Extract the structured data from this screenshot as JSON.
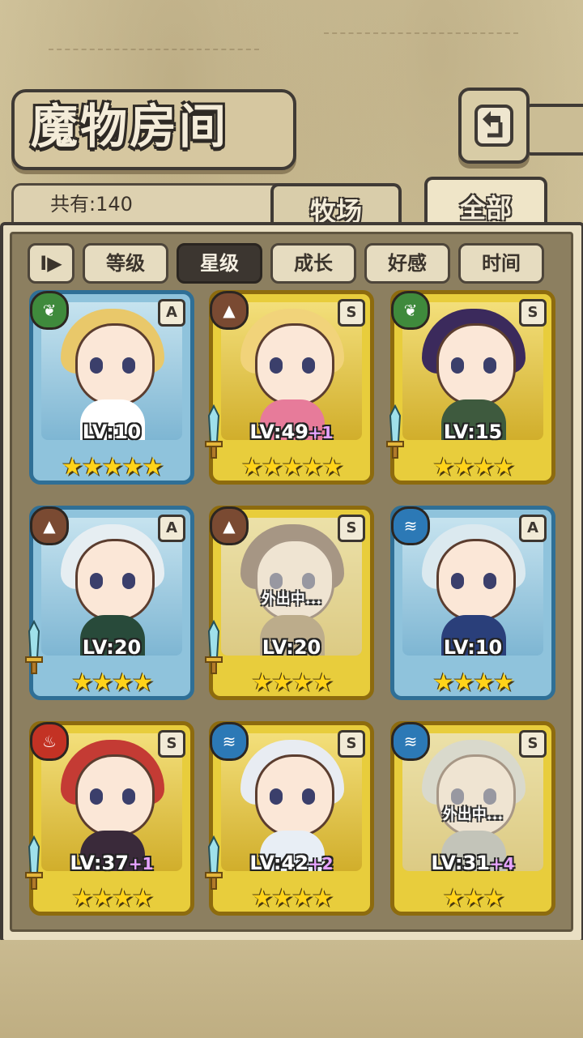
{
  "header": {
    "title": "魔物房间",
    "back_icon": "back-arrow-icon"
  },
  "count": {
    "text": "共有:140"
  },
  "tabs": [
    {
      "label": "牧场",
      "active": false
    },
    {
      "label": "全部",
      "active": true
    }
  ],
  "sort": {
    "toggle_label": "I▶",
    "buttons": [
      {
        "label": "等级",
        "active": false
      },
      {
        "label": "星级",
        "active": true
      },
      {
        "label": "成长",
        "active": false
      },
      {
        "label": "好感",
        "active": false
      },
      {
        "label": "时间",
        "active": false
      }
    ]
  },
  "away_label": "外出中...",
  "cards": [
    {
      "rarity": "A",
      "element": "wood",
      "level": "LV:10",
      "plus": "",
      "stars": "★★★★★",
      "away": false,
      "weapon": false
    },
    {
      "rarity": "S",
      "element": "earth",
      "level": "LV:49",
      "plus": "+1",
      "stars": "★★★★★",
      "away": false,
      "weapon": true
    },
    {
      "rarity": "S",
      "element": "wood",
      "level": "LV:15",
      "plus": "",
      "stars": "★★★★",
      "away": false,
      "weapon": true
    },
    {
      "rarity": "A",
      "element": "earth",
      "level": "LV:20",
      "plus": "",
      "stars": "★★★★",
      "away": false,
      "weapon": true
    },
    {
      "rarity": "S",
      "element": "earth",
      "level": "LV:20",
      "plus": "",
      "stars": "★★★★",
      "away": true,
      "weapon": true
    },
    {
      "rarity": "A",
      "element": "water",
      "level": "LV:10",
      "plus": "",
      "stars": "★★★★",
      "away": false,
      "weapon": false
    },
    {
      "rarity": "S",
      "element": "fire",
      "level": "LV:37",
      "plus": "+1",
      "stars": "★★★★",
      "away": false,
      "weapon": true
    },
    {
      "rarity": "S",
      "element": "water",
      "level": "LV:42",
      "plus": "+2",
      "stars": "★★★★",
      "away": false,
      "weapon": true
    },
    {
      "rarity": "S",
      "element": "water",
      "level": "LV:31",
      "plus": "+4",
      "stars": "★★★",
      "away": true,
      "weapon": false
    }
  ],
  "colors": {
    "element_wood": "#3f8a3c",
    "element_earth": "#7a4a32",
    "element_water": "#2c79b6",
    "element_fire": "#c33224"
  }
}
